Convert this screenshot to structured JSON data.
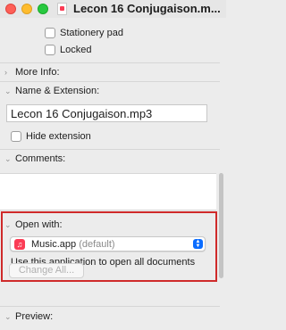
{
  "window": {
    "title": "Lecon 16 Conjugaison.m...",
    "file_icon": "music-file-icon"
  },
  "general": {
    "stationery_label": "Stationery pad",
    "stationery_checked": false,
    "locked_label": "Locked",
    "locked_checked": false
  },
  "sections": {
    "more_info": "More Info:",
    "name_extension": "Name & Extension:",
    "comments": "Comments:",
    "open_with": "Open with:",
    "preview": "Preview:"
  },
  "name_extension": {
    "filename": "Lecon 16 Conjugaison.mp3",
    "hide_extension_label": "Hide extension",
    "hide_extension_checked": false
  },
  "comments": {
    "value": ""
  },
  "open_with": {
    "app_name": "Music.app",
    "app_default": "(default)",
    "app_icon": "music-note-icon",
    "description": "Use this application to open all documents like this one.",
    "change_all_label": "Change All..."
  },
  "colors": {
    "highlight": "#cf2a2a",
    "popup_arrow": "#0a6cff",
    "music_icon": "#fb3c55"
  }
}
